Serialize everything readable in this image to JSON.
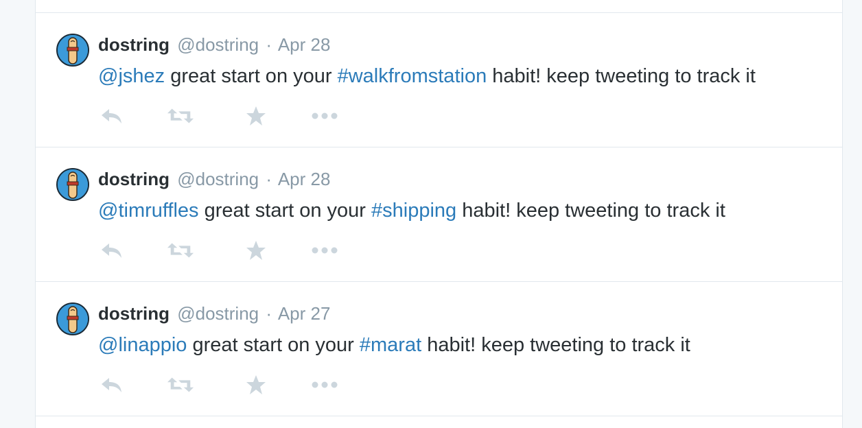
{
  "colors": {
    "link": "#2b7bb9",
    "text": "#292f33",
    "muted": "#8899a6",
    "icon": "#ccd6dd",
    "border": "#e1e8ed"
  },
  "tweets": [
    {
      "name": "dostring",
      "handle": "@dostring",
      "separator": "·",
      "date": "Apr 28",
      "mention": "@jshez",
      "text_before_tag": " great start on your ",
      "hashtag": "#walkfromstation",
      "text_after_tag": " habit! keep tweeting to track it",
      "avatar_icon": "finger-avatar-icon"
    },
    {
      "name": "dostring",
      "handle": "@dostring",
      "separator": "·",
      "date": "Apr 28",
      "mention": "@timruffles",
      "text_before_tag": " great start on your ",
      "hashtag": "#shipping",
      "text_after_tag": " habit! keep tweeting to track it",
      "avatar_icon": "finger-avatar-icon"
    },
    {
      "name": "dostring",
      "handle": "@dostring",
      "separator": "·",
      "date": "Apr 27",
      "mention": "@linappio",
      "text_before_tag": " great start on your ",
      "hashtag": "#marat",
      "text_after_tag": " habit! keep tweeting to track it",
      "avatar_icon": "finger-avatar-icon"
    }
  ],
  "actions": [
    "reply-icon",
    "retweet-icon",
    "favorite-icon",
    "more-icon"
  ]
}
